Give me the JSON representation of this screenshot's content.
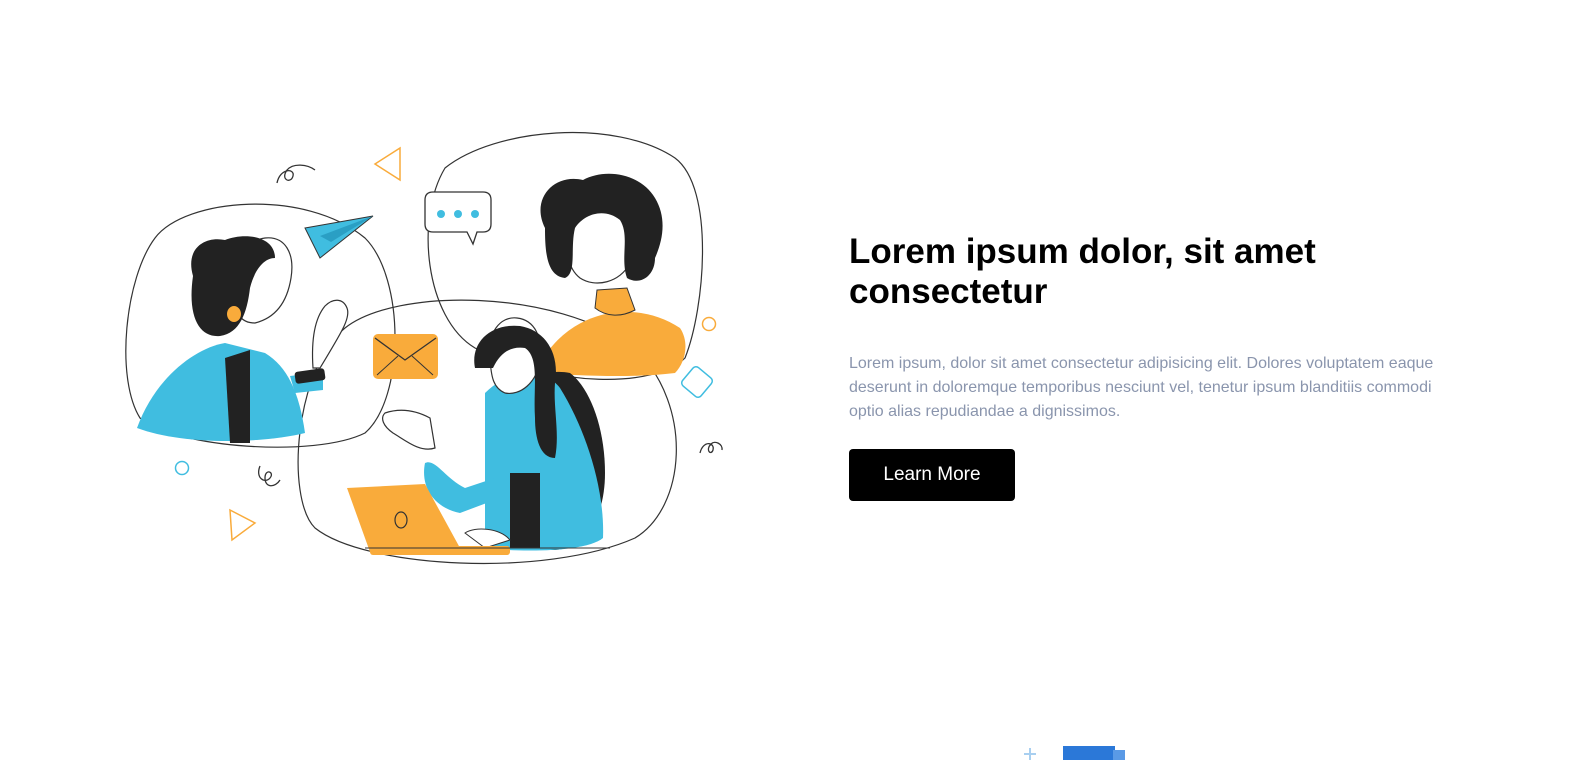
{
  "hero": {
    "headline": "Lorem ipsum dolor, sit amet consectetur",
    "body": "Lorem ipsum, dolor sit amet consectetur adipisicing elit. Dolores voluptatem eaque deserunt in doloremque temporibus nesciunt vel, tenetur ipsum blanditiis commodi optio alias repudiandae a dignissimos.",
    "cta_label": "Learn More",
    "illustration": "three-people-video-chat-illustration"
  },
  "colors": {
    "accent_blue": "#40bde0",
    "accent_orange": "#f9ab3b",
    "body_text": "#8a95ad",
    "button_bg": "#000000",
    "next_section_blue": "#2b78d8"
  }
}
